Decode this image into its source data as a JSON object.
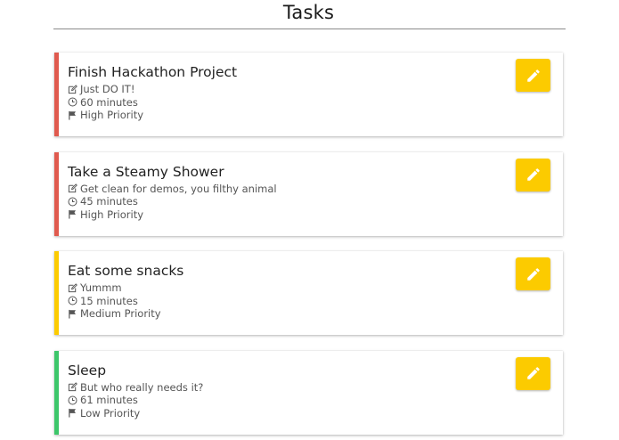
{
  "header": {
    "title": "Tasks"
  },
  "colors": {
    "high": "#e05a4e",
    "medium": "#fccb00",
    "low": "#3cc66a",
    "edit_button": "#fccb00"
  },
  "tasks": [
    {
      "name": "Finish Hackathon Project",
      "description": "Just DO IT!",
      "duration": "60 minutes",
      "priority": "High Priority",
      "priority_level": "high"
    },
    {
      "name": "Take a Steamy Shower",
      "description": "Get clean for demos, you filthy animal",
      "duration": "45 minutes",
      "priority": "High Priority",
      "priority_level": "high"
    },
    {
      "name": "Eat some snacks",
      "description": "Yummm",
      "duration": "15 minutes",
      "priority": "Medium Priority",
      "priority_level": "medium"
    },
    {
      "name": "Sleep",
      "description": "But who really needs it?",
      "duration": "61 minutes",
      "priority": "Low Priority",
      "priority_level": "low"
    }
  ],
  "icons": {
    "description": "edit-square-icon",
    "duration": "clock-icon",
    "priority": "flag-icon",
    "edit_button": "pencil-icon"
  }
}
